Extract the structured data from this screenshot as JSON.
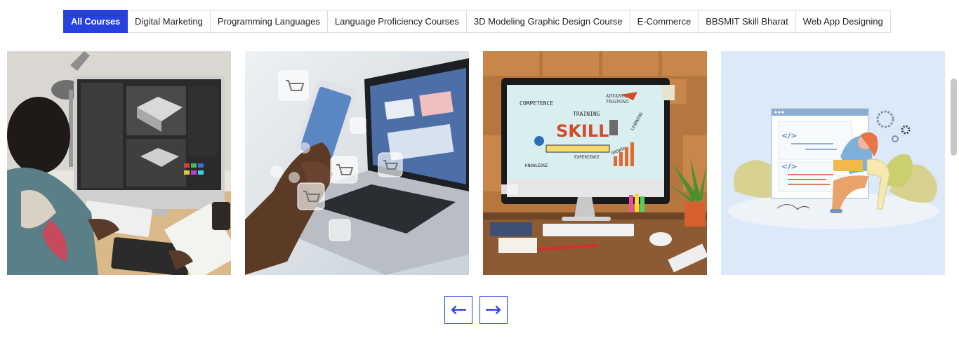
{
  "filter_tabs": [
    {
      "label": "All Courses",
      "active": true
    },
    {
      "label": "Digital Marketing",
      "active": false
    },
    {
      "label": "Programming Languages",
      "active": false
    },
    {
      "label": "Language Proficiency Courses",
      "active": false
    },
    {
      "label": "3D Modeling Graphic Design Course",
      "active": false
    },
    {
      "label": "E-Commerce",
      "active": false
    },
    {
      "label": "BBSMIT Skill Bharat",
      "active": false
    },
    {
      "label": "Web App Designing",
      "active": false
    }
  ],
  "cards": [
    {
      "image": "3d-modeling-workstation-photo"
    },
    {
      "image": "ecommerce-phone-laptop-photo"
    },
    {
      "image": "skill-training-monitor-photo",
      "screen_words": {
        "skill": "SKILL",
        "competence": "COMPETENCE",
        "training": "TRAINING",
        "advanced": "ADVANCED",
        "advanced2": "TRAINING",
        "learning": "LEARNING",
        "knowledge": "KNOWLEDGE",
        "experience": "EXPERIENCE",
        "growth": "GROWTH"
      }
    },
    {
      "image": "web-app-designing-illustration",
      "code_tag_1": "</>",
      "code_tag_2": "</>"
    }
  ],
  "pager": {
    "prev_icon": "arrow-left-icon",
    "next_icon": "arrow-right-icon"
  },
  "colors": {
    "accent": "#2740e0",
    "border": "#dcdcdc"
  }
}
